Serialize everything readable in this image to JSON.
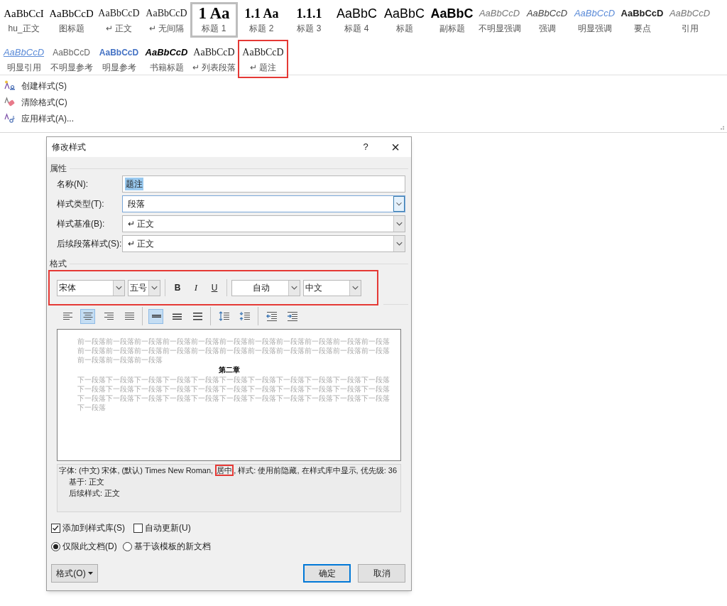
{
  "style_gallery": {
    "rows": [
      [
        {
          "sample": "AaBbCcI",
          "label": "hu_正文",
          "kind": "normal",
          "selected": false,
          "annotated": false
        },
        {
          "sample": "AaBbCcD",
          "label": "图标题",
          "kind": "normal",
          "selected": false,
          "annotated": false
        },
        {
          "sample": "AaBbCcD",
          "label": "↵ 正文",
          "kind": "plain",
          "selected": false,
          "annotated": false
        },
        {
          "sample": "AaBbCcD",
          "label": "↵ 无间隔",
          "kind": "plain",
          "selected": false,
          "annotated": false
        },
        {
          "sample": "1 Aa",
          "label": "标题 1",
          "kind": "heading-1",
          "selected": true,
          "annotated": false
        },
        {
          "sample": "1.1 Aa",
          "label": "标题 2",
          "kind": "heading",
          "selected": false,
          "annotated": false
        },
        {
          "sample": "1.1.1",
          "label": "标题 3",
          "kind": "heading",
          "selected": false,
          "annotated": false
        },
        {
          "sample": "AaBbC",
          "label": "标题 4",
          "kind": "heading-sans",
          "selected": false,
          "annotated": false
        },
        {
          "sample": "AaBbC",
          "label": "标题",
          "kind": "heading-sans",
          "selected": false,
          "annotated": false
        },
        {
          "sample": "AaBbC",
          "label": "副标题",
          "kind": "subtitle",
          "selected": false,
          "annotated": false
        },
        {
          "sample": "AaBbCcD",
          "label": "不明显强调",
          "kind": "subtle-italic",
          "selected": false,
          "annotated": false
        },
        {
          "sample": "AaBbCcD",
          "label": "强调",
          "kind": "emphasis",
          "selected": false,
          "annotated": false
        },
        {
          "sample": "AaBbCcD",
          "label": "明显强调",
          "kind": "intense-emphasis",
          "selected": false,
          "annotated": false
        },
        {
          "sample": "AaBbCcD",
          "label": "要点",
          "kind": "strong",
          "selected": false,
          "annotated": false
        },
        {
          "sample": "AaBbCcD",
          "label": "引用",
          "kind": "subtle-italic",
          "selected": false,
          "annotated": false
        }
      ],
      [
        {
          "sample": "AaBbCcD",
          "label": "明显引用",
          "kind": "intense-quote",
          "selected": false,
          "annotated": false
        },
        {
          "sample": "AaBbCcD",
          "label": "不明显参考",
          "kind": "subtle-reference",
          "selected": false,
          "annotated": false
        },
        {
          "sample": "AaBbCcD",
          "label": "明显参考",
          "kind": "intense-reference",
          "selected": false,
          "annotated": false
        },
        {
          "sample": "AaBbCcD",
          "label": "书籍标题",
          "kind": "book-title",
          "selected": false,
          "annotated": false
        },
        {
          "sample": "AaBbCcD",
          "label": "↵ 列表段落",
          "kind": "plain",
          "selected": false,
          "annotated": false
        },
        {
          "sample": "AaBbCcD",
          "label": "↵ 题注",
          "kind": "plain",
          "selected": false,
          "annotated": true
        }
      ]
    ]
  },
  "gallery_menu": [
    {
      "label": "创建样式(S)",
      "kind": "new-style"
    },
    {
      "label": "清除格式(C)",
      "kind": "clear"
    },
    {
      "label": "应用样式(A)...",
      "kind": "apply"
    }
  ],
  "dialog": {
    "title": "修改样式",
    "help": "?",
    "close": "×",
    "properties_label": "属性",
    "fields": [
      {
        "label": "名称(N):",
        "value": "题注",
        "kind": "text",
        "text_selected": true,
        "focused": false
      },
      {
        "label": "样式类型(T):",
        "value": "段落",
        "kind": "dropdown",
        "text_selected": false,
        "focused": true
      },
      {
        "label": "样式基准(B):",
        "value": "↵ 正文",
        "kind": "dropdown",
        "text_selected": false,
        "focused": false
      },
      {
        "label": "后续段落样式(S):",
        "value": "↵ 正文",
        "kind": "dropdown",
        "text_selected": false,
        "focused": false
      }
    ],
    "format_label": "格式",
    "format_toolbar": {
      "annotated": true,
      "font": "宋体",
      "size": "五号",
      "bold": "B",
      "italic": "I",
      "underline": "U",
      "color_setting": "自动",
      "language": "中文"
    },
    "paragraph_buttons": [
      [
        {
          "kind": "align-left",
          "selected": false
        },
        {
          "kind": "align-center",
          "selected": true
        },
        {
          "kind": "align-right",
          "selected": false
        },
        {
          "kind": "justify",
          "selected": false
        }
      ],
      [
        {
          "kind": "single-spacing",
          "selected": true
        },
        {
          "kind": "one-half-spacing",
          "selected": false
        },
        {
          "kind": "double-spacing",
          "selected": false
        }
      ],
      [
        {
          "kind": "space-increase",
          "selected": false
        },
        {
          "kind": "space-decrease",
          "selected": false
        }
      ],
      [
        {
          "kind": "indent-decrease",
          "selected": false
        },
        {
          "kind": "indent-increase",
          "selected": false
        }
      ]
    ],
    "preview": {
      "previous_lines": [
        "前一段落前一段落前一段落前一段落前一段落前一段落前一段落前一段落前一段落前一段落前一段落",
        "前一段落前一段落前一段落前一段落前一段落前一段落前一段落前一段落前一段落前一段落前一段落",
        "前一段落前一段落前一段落"
      ],
      "sample": "第二章",
      "next_lines": [
        "下一段落下一段落下一段落下一段落下一段落下一段落下一段落下一段落下一段落下一段落下一段落",
        "下一段落下一段落下一段落下一段落下一段落下一段落下一段落下一段落下一段落下一段落下一段落",
        "下一段落下一段落下一段落下一段落下一段落下一段落下一段落下一段落下一段落下一段落下一段落",
        "下一段落"
      ]
    },
    "description": {
      "before": "字体: (中文) 宋体, (默认) Times New Roman, ",
      "highlight": "居中",
      "after": ", 样式: 使用前隐藏, 在样式库中显示, 优先级: 36",
      "based_on": "基于: 正文",
      "following": "后续样式: 正文"
    },
    "options": [
      {
        "label": "添加到样式库(S)",
        "checked": true
      },
      {
        "label": "自动更新(U)",
        "checked": false
      }
    ],
    "scope": [
      {
        "label": "仅限此文档(D)",
        "selected": true
      },
      {
        "label": "基于该模板的新文档",
        "selected": false
      }
    ],
    "buttons": [
      {
        "label": "格式(O)",
        "kind": "menu"
      },
      {
        "label": "确定",
        "kind": "default"
      },
      {
        "label": "取消",
        "kind": "normal"
      }
    ]
  }
}
